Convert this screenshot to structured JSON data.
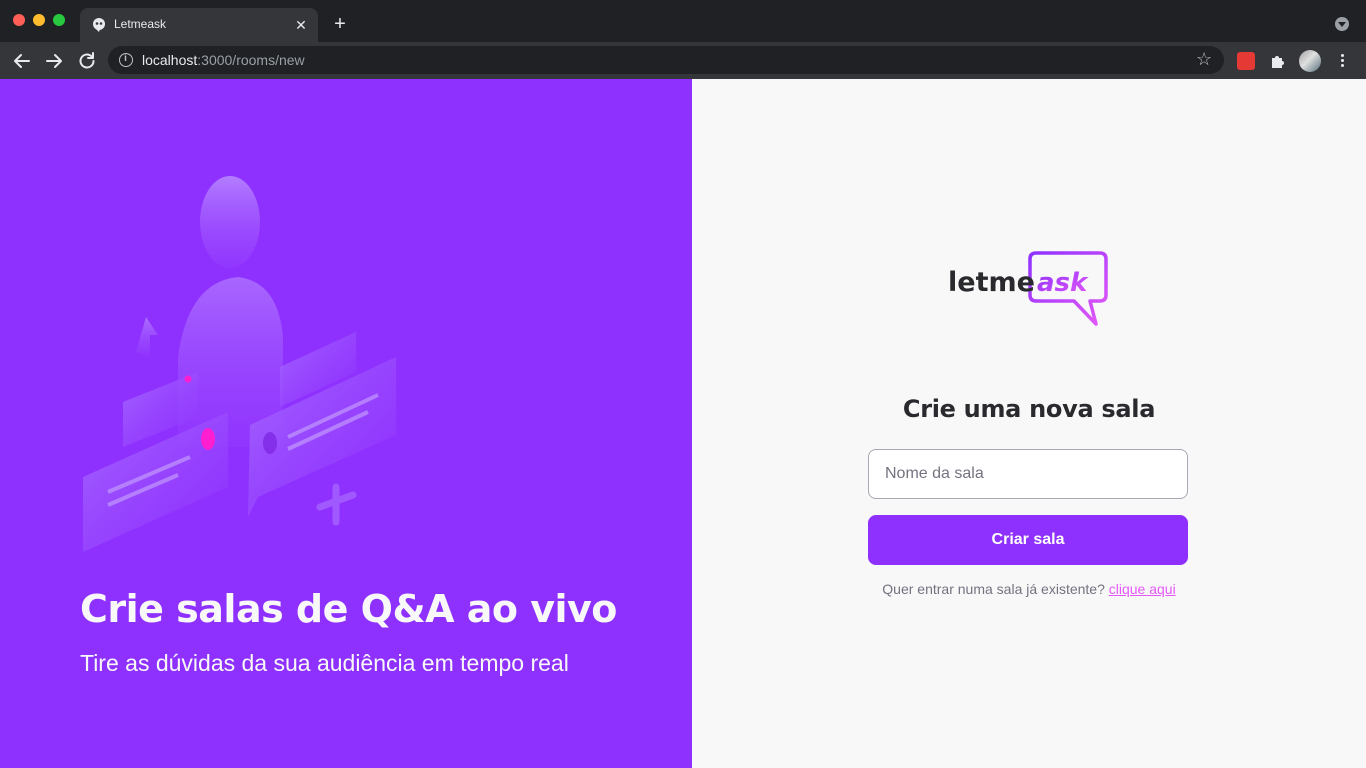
{
  "browser": {
    "tab_title": "Letmeask",
    "url_host": "localhost",
    "url_path": ":3000/rooms/new",
    "new_tab_symbol": "+",
    "close_symbol": "✕",
    "star_symbol": "☆"
  },
  "aside": {
    "title": "Crie salas de Q&A ao vivo",
    "subtitle": "Tire as dúvidas da sua audiência em tempo real"
  },
  "logo": {
    "word_dark": "letme",
    "word_accent": "ask"
  },
  "form": {
    "title": "Crie uma nova sala",
    "input_placeholder": "Nome da sala",
    "input_value": "",
    "submit_label": "Criar sala",
    "join_prompt": "Quer entrar numa sala já existente?",
    "join_link": "clique aqui"
  },
  "colors": {
    "brand_purple": "#8f31fe",
    "accent_pink": "#e559f9",
    "background_light": "#f8f8f8",
    "text_dark": "#29292e"
  },
  "icons": [
    "favicon-icon",
    "close-icon",
    "new-tab-icon",
    "tab-menu-icon",
    "back-icon",
    "forward-icon",
    "reload-icon",
    "info-icon",
    "star-icon",
    "extension-icon",
    "puzzle-icon",
    "profile-avatar",
    "kebab-menu-icon"
  ]
}
